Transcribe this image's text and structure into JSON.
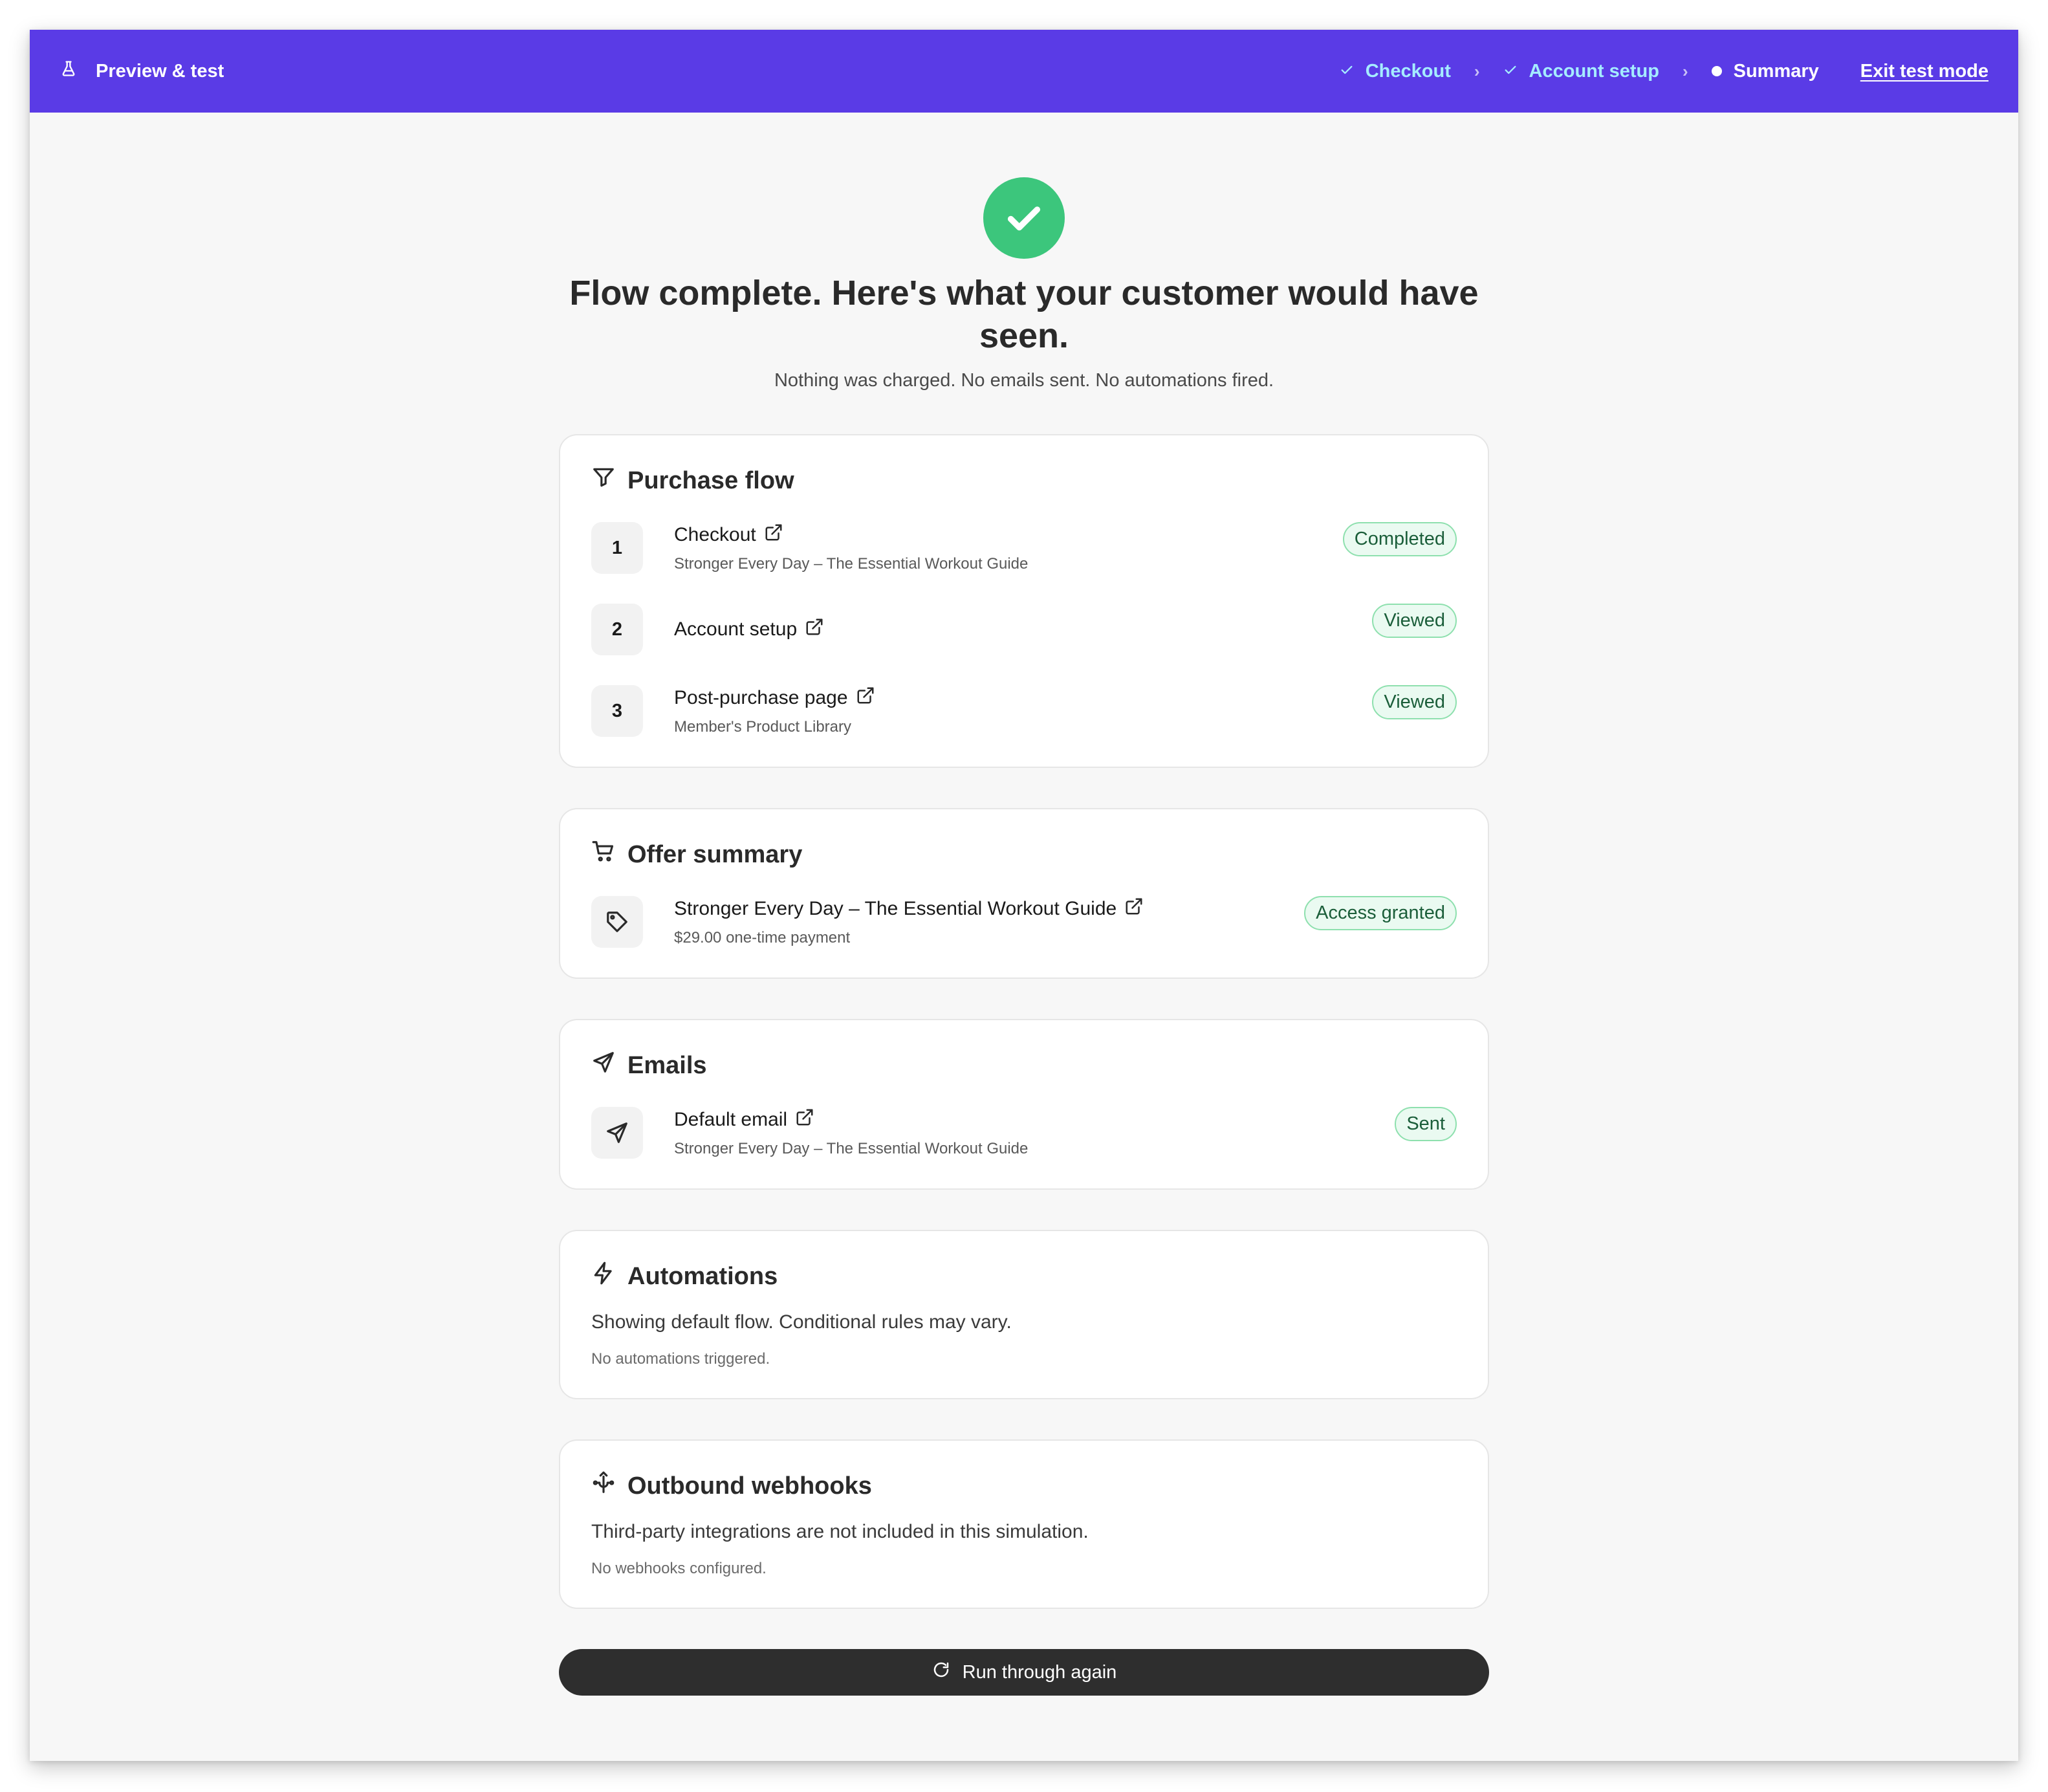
{
  "topbar": {
    "brand_label": "Preview & test",
    "steps": [
      {
        "label": "Checkout",
        "state": "done"
      },
      {
        "label": "Account setup",
        "state": "done"
      },
      {
        "label": "Summary",
        "state": "active"
      }
    ],
    "exit_label": "Exit test mode",
    "accent_color": "#5a3be6"
  },
  "hero": {
    "title": "Flow complete. Here's what your customer would have seen.",
    "subtitle": "Nothing was charged. No emails sent. No automations fired."
  },
  "purchase_flow": {
    "title": "Purchase flow",
    "items": [
      {
        "num": "1",
        "title": "Checkout",
        "subtitle": "Stronger Every Day – The Essential Workout Guide",
        "status": "Completed"
      },
      {
        "num": "2",
        "title": "Account setup",
        "subtitle": "",
        "status": "Viewed"
      },
      {
        "num": "3",
        "title": "Post-purchase page",
        "subtitle": "Member's Product Library",
        "status": "Viewed"
      }
    ]
  },
  "offer_summary": {
    "title": "Offer summary",
    "item": {
      "title": "Stronger Every Day – The Essential Workout Guide",
      "subtitle": "$29.00 one-time payment",
      "status": "Access granted",
      "icon": "tag-icon"
    }
  },
  "emails": {
    "title": "Emails",
    "item": {
      "title": "Default email",
      "subtitle": "Stronger Every Day – The Essential Workout Guide",
      "status": "Sent",
      "icon": "send-icon"
    }
  },
  "automations": {
    "title": "Automations",
    "description": "Showing default flow. Conditional rules may vary.",
    "note": "No automations triggered."
  },
  "webhooks": {
    "title": "Outbound webhooks",
    "description": "Third-party integrations are not included in this simulation.",
    "note": "No webhooks configured."
  },
  "run_again_label": "Run through again",
  "colors": {
    "success": "#3cc67c",
    "badge_border": "#8ee0ae",
    "button_dark": "#2e2e2e"
  }
}
